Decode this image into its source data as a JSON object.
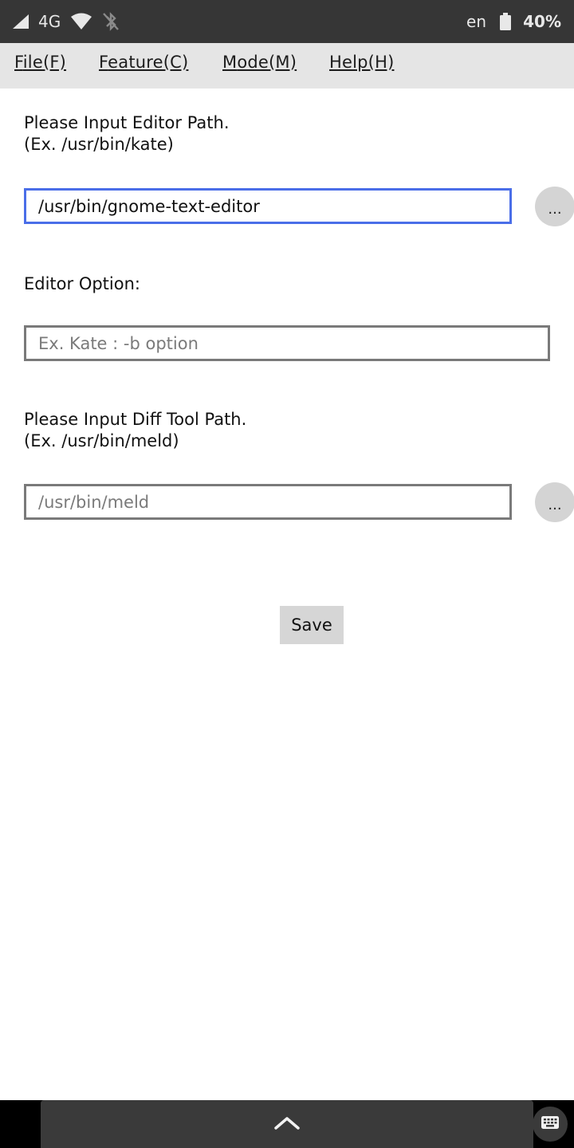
{
  "status_bar": {
    "network": "4G",
    "language": "en",
    "battery": "40%",
    "icons": [
      "signal-icon",
      "wifi-icon",
      "bluetooth-off-icon",
      "battery-icon"
    ]
  },
  "menu": {
    "items": [
      {
        "mnemonic": "F",
        "rest": "ile(F)"
      },
      {
        "mnemonic": "F",
        "rest": "eature(C)"
      },
      {
        "mnemonic": "M",
        "rest": "ode(M)"
      },
      {
        "mnemonic": "H",
        "rest": "elp(H)"
      }
    ]
  },
  "editor": {
    "label": "Please Input Editor Path.\n(Ex. /usr/bin/kate)",
    "value": "/usr/bin/gnome-text-editor",
    "browse_label": "..."
  },
  "editor_option": {
    "label": "Editor Option:",
    "value": "",
    "placeholder": "Ex. Kate : -b option"
  },
  "diff_tool": {
    "label": "Please Input Diff Tool Path.\n(Ex. /usr/bin/meld)",
    "value": "",
    "placeholder": "/usr/bin/meld",
    "browse_label": "..."
  },
  "save_label": "Save",
  "nav": {
    "icons": [
      "chevron-up-icon",
      "keyboard-icon"
    ]
  }
}
